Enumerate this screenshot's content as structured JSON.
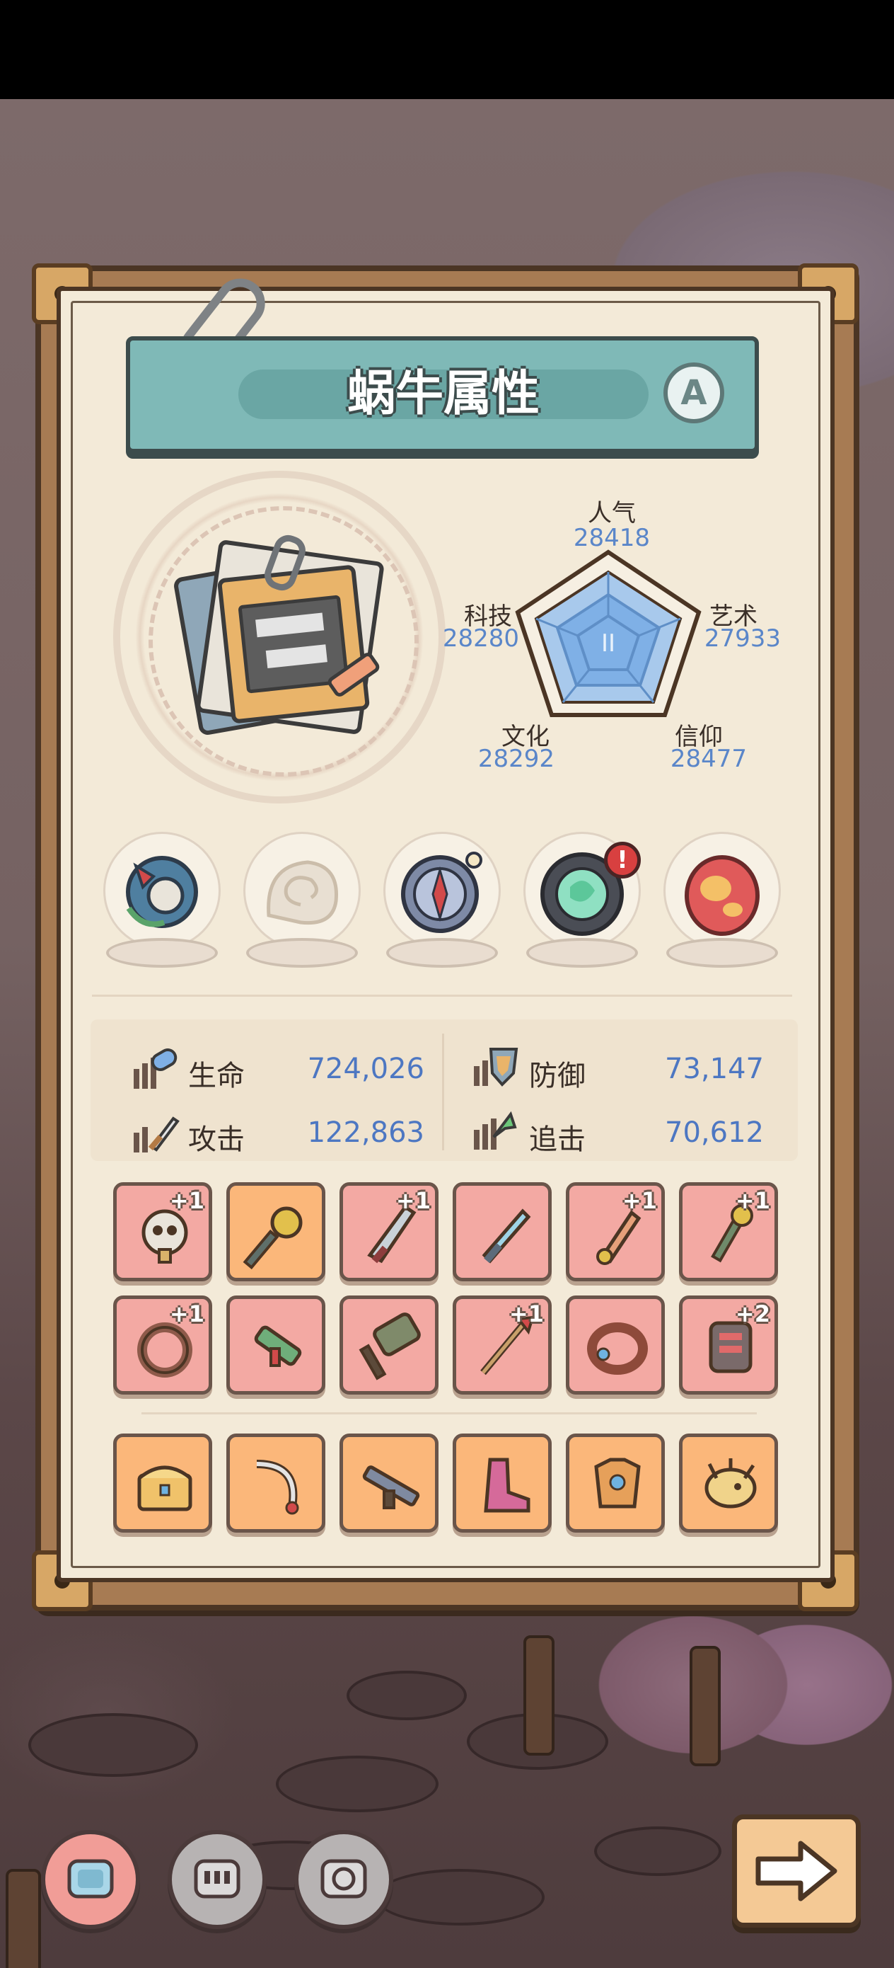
{
  "title": "蜗牛属性",
  "rank": "A",
  "radar": {
    "popularity": {
      "label": "人气",
      "value": "28418"
    },
    "art": {
      "label": "艺术",
      "value": "27933"
    },
    "faith": {
      "label": "信仰",
      "value": "28477"
    },
    "culture": {
      "label": "文化",
      "value": "28292"
    },
    "tech": {
      "label": "科技",
      "value": "28280"
    },
    "center_glyph": "II"
  },
  "stats": {
    "hp": {
      "label": "生命",
      "value": "724,026"
    },
    "defense": {
      "label": "防御",
      "value": "73,147"
    },
    "attack": {
      "label": "攻击",
      "value": "122,863"
    },
    "pursuit": {
      "label": "追击",
      "value": "70,612"
    }
  },
  "relics": [
    {
      "name": "serpent-ring-relic",
      "alert": ""
    },
    {
      "name": "shell-fossil-relic",
      "alert": ""
    },
    {
      "name": "compass-relic",
      "alert": ""
    },
    {
      "name": "green-orb-relic",
      "alert": "!"
    },
    {
      "name": "red-egg-relic",
      "alert": ""
    }
  ],
  "equipment_row1": [
    {
      "icon": "skull-relic-icon",
      "plus": "+1",
      "tone": "red"
    },
    {
      "icon": "mace-icon",
      "plus": "",
      "tone": "orange"
    },
    {
      "icon": "dagger-icon",
      "plus": "+1",
      "tone": "red"
    },
    {
      "icon": "sword-icon",
      "plus": "",
      "tone": "red"
    },
    {
      "icon": "rocket-blade-icon",
      "plus": "+1",
      "tone": "red"
    },
    {
      "icon": "serpent-staff-icon",
      "plus": "+1",
      "tone": "red"
    }
  ],
  "equipment_row2": [
    {
      "icon": "bracelet-icon",
      "plus": "+1",
      "tone": "red"
    },
    {
      "icon": "blaster-icon",
      "plus": "",
      "tone": "red"
    },
    {
      "icon": "hammer-icon",
      "plus": "",
      "tone": "red"
    },
    {
      "icon": "spear-icon",
      "plus": "+1",
      "tone": "red"
    },
    {
      "icon": "ring-icon",
      "plus": "",
      "tone": "red"
    },
    {
      "icon": "circuit-chip-icon",
      "plus": "+2",
      "tone": "red"
    }
  ],
  "equipment_row3": [
    {
      "icon": "treasure-chest-icon",
      "plus": "",
      "tone": "orange"
    },
    {
      "icon": "scimitar-icon",
      "plus": "",
      "tone": "orange"
    },
    {
      "icon": "rifle-icon",
      "plus": "",
      "tone": "orange"
    },
    {
      "icon": "boot-icon",
      "plus": "",
      "tone": "orange"
    },
    {
      "icon": "armor-icon",
      "plus": "",
      "tone": "orange"
    },
    {
      "icon": "creature-icon",
      "plus": "",
      "tone": "orange"
    }
  ],
  "nav": [
    {
      "icon": "snail-attributes-icon",
      "active": true
    },
    {
      "icon": "robot-face-icon",
      "active": false
    },
    {
      "icon": "gear-face-icon",
      "active": false
    }
  ],
  "next": {
    "icon": "arrow-right-icon"
  },
  "colors": {
    "banner": "#7fb9b7",
    "value_blue": "#4d77c2",
    "slot_red": "#f3a9a3",
    "slot_orange": "#fbb77a"
  }
}
